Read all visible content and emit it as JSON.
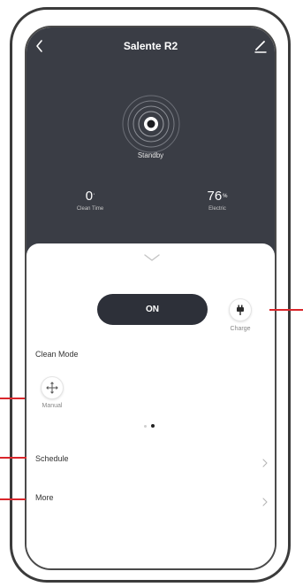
{
  "header": {
    "title": "Salente R2",
    "back_icon": "chevron-left-icon",
    "edit_icon": "pencil-icon"
  },
  "status": {
    "text": "Standby",
    "icon": "concentric-rings-icon"
  },
  "stats": [
    {
      "value": "0",
      "unit": "'",
      "label": "Clean Time"
    },
    {
      "value": "76",
      "unit": "%",
      "label": "Electric"
    }
  ],
  "controls": {
    "power_label": "ON",
    "charge_label": "Charge",
    "charge_icon": "plug-icon"
  },
  "clean_mode": {
    "heading": "Clean Mode",
    "modes": [
      {
        "label": "Manual",
        "icon": "move-arrows-icon"
      }
    ],
    "pager": {
      "pages": 2,
      "active_page": 2
    }
  },
  "menu": {
    "items": [
      {
        "label": "Schedule"
      },
      {
        "label": "More"
      }
    ]
  },
  "colors": {
    "dark_panel": "#3a3d45",
    "power_button": "#2d3039",
    "callout_line": "#d9262b"
  }
}
